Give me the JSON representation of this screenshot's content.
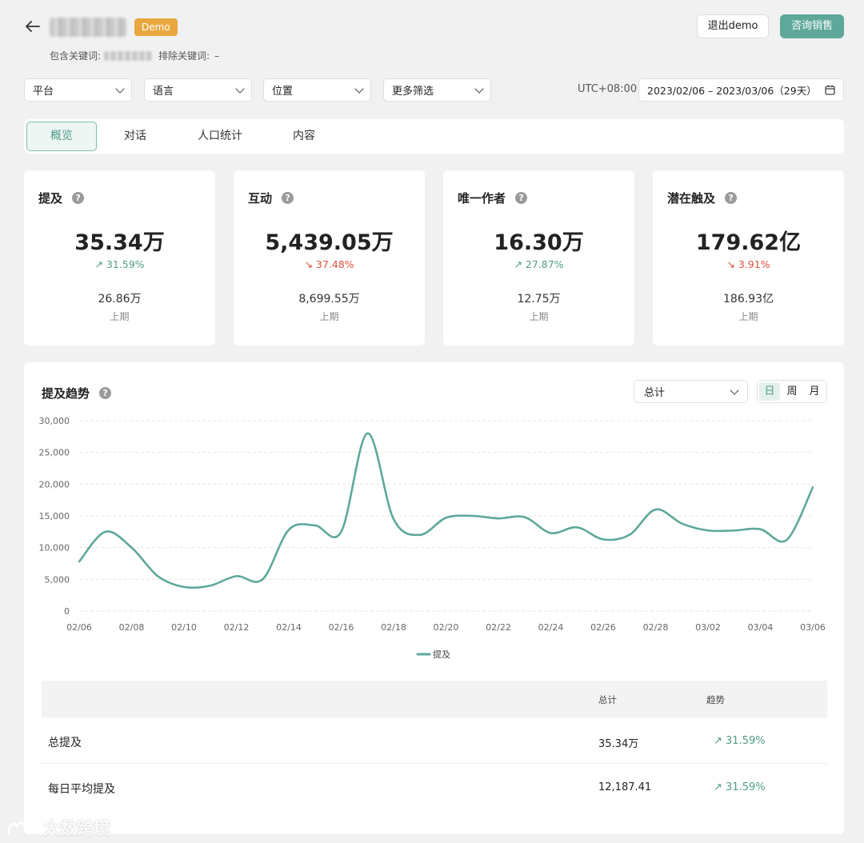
{
  "header": {
    "demo_badge": "Demo",
    "include_keywords_label": "包含关键词:",
    "exclude_keywords_label": "排除关键词:",
    "exclude_keywords_value": "–",
    "exit_demo_label": "退出demo",
    "contact_sales_label": "咨询销售"
  },
  "filters": {
    "platform": "平台",
    "language": "语言",
    "location": "位置",
    "more": "更多筛选",
    "timezone": "UTC+08:00",
    "date_range": "2023/02/06 – 2023/03/06（29天）"
  },
  "tabs": [
    {
      "label": "概览",
      "active": true
    },
    {
      "label": "对话",
      "active": false
    },
    {
      "label": "人口统计",
      "active": false
    },
    {
      "label": "内容",
      "active": false
    }
  ],
  "metrics": [
    {
      "title": "提及",
      "value": "35.34万",
      "change": "31.59%",
      "direction": "up",
      "prev_value": "26.86万",
      "prev_label": "上期"
    },
    {
      "title": "互动",
      "value": "5,439.05万",
      "change": "37.48%",
      "direction": "down",
      "prev_value": "8,699.55万",
      "prev_label": "上期"
    },
    {
      "title": "唯一作者",
      "value": "16.30万",
      "change": "27.87%",
      "direction": "up",
      "prev_value": "12.75万",
      "prev_label": "上期"
    },
    {
      "title": "潜在触及",
      "value": "179.62亿",
      "change": "3.91%",
      "direction": "down",
      "prev_value": "186.93亿",
      "prev_label": "上期"
    }
  ],
  "trend": {
    "title": "提及趋势",
    "aggregation": "总计",
    "granularity": [
      {
        "label": "日",
        "active": true
      },
      {
        "label": "周",
        "active": false
      },
      {
        "label": "月",
        "active": false
      }
    ]
  },
  "chart_data": {
    "type": "line",
    "x": [
      "02/06",
      "02/07",
      "02/08",
      "02/09",
      "02/10",
      "02/11",
      "02/12",
      "02/13",
      "02/14",
      "02/15",
      "02/16",
      "02/17",
      "02/18",
      "02/19",
      "02/20",
      "02/21",
      "02/22",
      "02/23",
      "02/24",
      "02/25",
      "02/26",
      "02/27",
      "02/28",
      "03/01",
      "03/02",
      "03/03",
      "03/04",
      "03/05",
      "03/06"
    ],
    "x_tick_labels": [
      "02/06",
      "02/08",
      "02/10",
      "02/12",
      "02/14",
      "02/16",
      "02/18",
      "02/20",
      "02/22",
      "02/24",
      "02/26",
      "02/28",
      "03/02",
      "03/04",
      "03/06"
    ],
    "y_tick_labels": [
      "30,000",
      "25,000",
      "20,000",
      "15,000",
      "10,000",
      "5,000",
      "0"
    ],
    "series": [
      {
        "name": "提及",
        "color": "#5ea89a",
        "values": [
          7800,
          12500,
          10000,
          5500,
          3800,
          4000,
          5500,
          5000,
          12800,
          13500,
          12500,
          28000,
          14500,
          12000,
          14700,
          15000,
          14600,
          14800,
          12300,
          13200,
          11300,
          12000,
          16000,
          13800,
          12700,
          12700,
          12900,
          11200,
          19500
        ]
      }
    ],
    "ylim": [
      0,
      30000
    ],
    "grid": true,
    "legend_position": "bottom-center"
  },
  "table": {
    "headers": {
      "total": "总计",
      "trend": "趋势"
    },
    "rows": [
      {
        "label": "总提及",
        "total": "35.34万",
        "trend": "31.59%"
      },
      {
        "label": "每日平均提及",
        "total": "12,187.41",
        "trend": "31.59%"
      }
    ]
  },
  "watermark": "大数跨境"
}
